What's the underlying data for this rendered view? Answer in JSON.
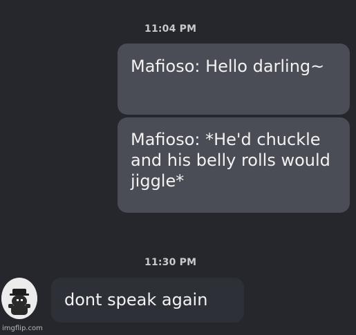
{
  "chat": {
    "timestamp_1": "11:04 PM",
    "timestamp_2": "11:30 PM",
    "messages": [
      {
        "side": "outgoing",
        "text": "Mafioso: Hello darling~"
      },
      {
        "side": "outgoing",
        "text": "Mafioso: *He'd chuckle and his belly rolls would jiggle*"
      },
      {
        "side": "incoming",
        "text": "dont speak again"
      }
    ]
  },
  "watermark": "imgflip.com",
  "colors": {
    "background": "#25272d",
    "outgoing_bubble": "#4a4d55",
    "incoming_bubble": "#2e3037",
    "text": "#f2f2f2"
  },
  "icons": {
    "avatar": "user-avatar-icon"
  }
}
